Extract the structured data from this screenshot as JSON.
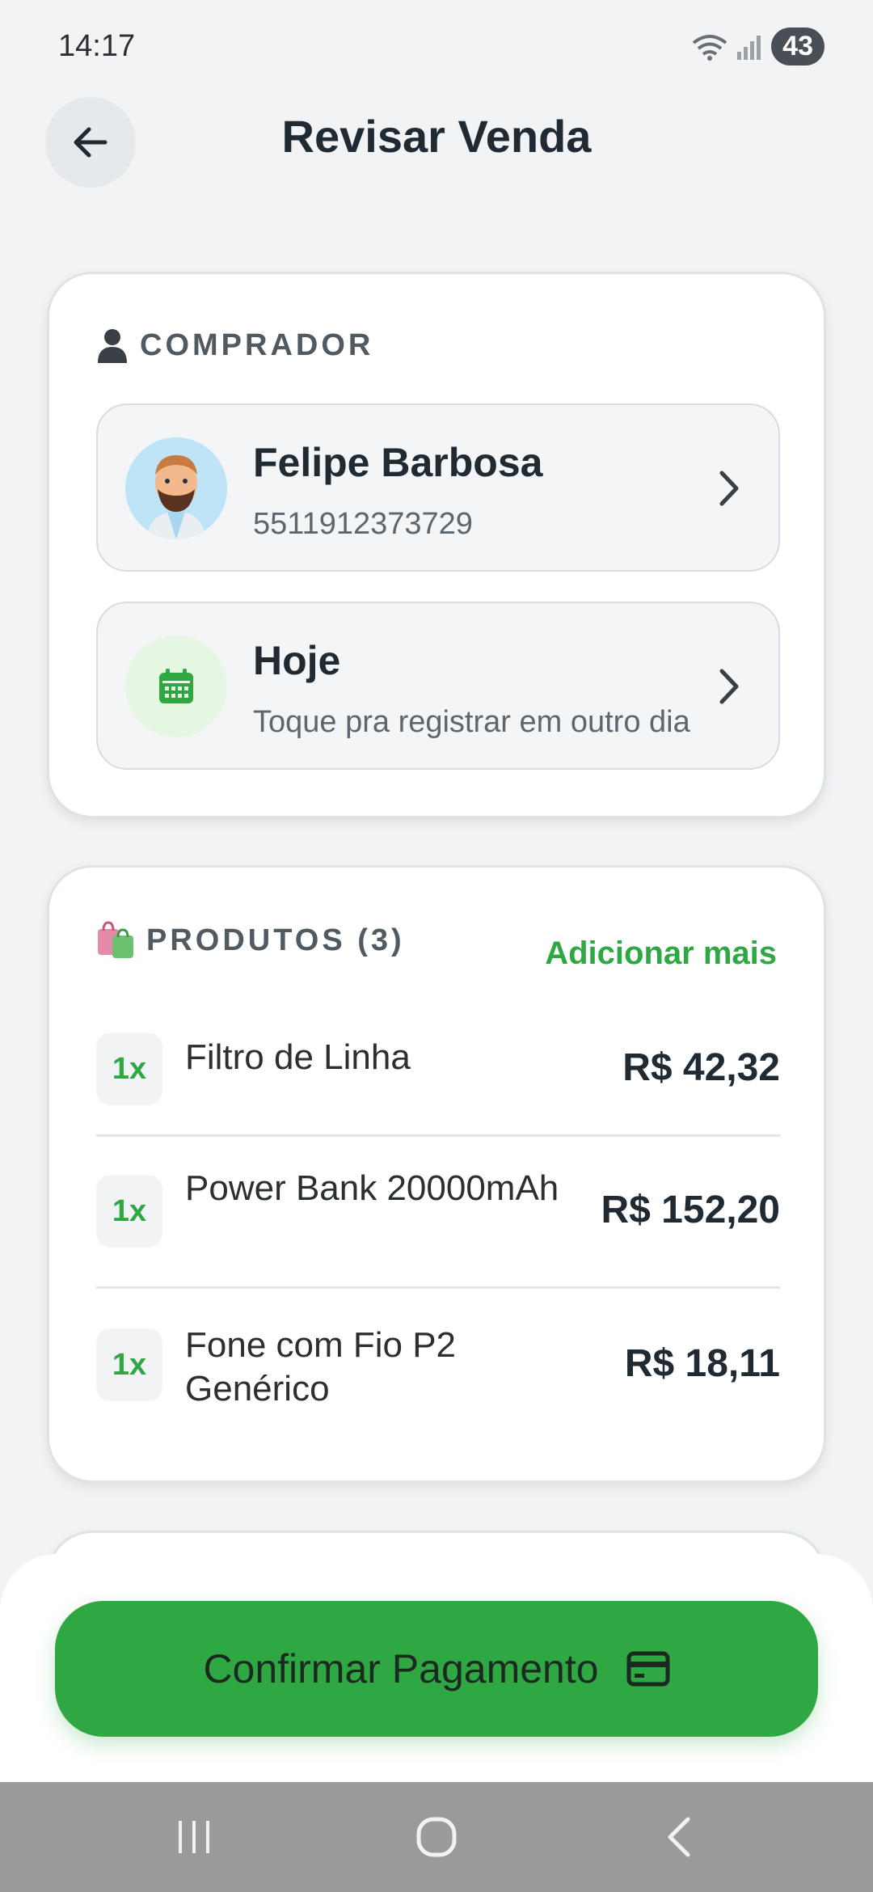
{
  "status_bar": {
    "time": "14:17",
    "battery": "43"
  },
  "header": {
    "title": "Revisar Venda"
  },
  "buyer_section": {
    "label": "COMPRADOR",
    "buyer": {
      "name": "Felipe Barbosa",
      "phone": "5511912373729"
    },
    "date": {
      "title": "Hoje",
      "subtitle": "Toque pra registrar em outro dia"
    }
  },
  "products_section": {
    "label": "PRODUTOS (3)",
    "add_more": "Adicionar mais",
    "items": [
      {
        "qty": "1x",
        "name": "Filtro de Linha",
        "price": "R$ 42,32"
      },
      {
        "qty": "1x",
        "name": "Power Bank 20000mAh",
        "price": "R$ 152,20"
      },
      {
        "qty": "1x",
        "name": "Fone com Fio P2 Genérico",
        "price": "R$ 18,11"
      }
    ]
  },
  "footer": {
    "confirm_label": "Confirmar Pagamento"
  },
  "colors": {
    "accent": "#2fa843",
    "background": "#f1f3f5"
  }
}
